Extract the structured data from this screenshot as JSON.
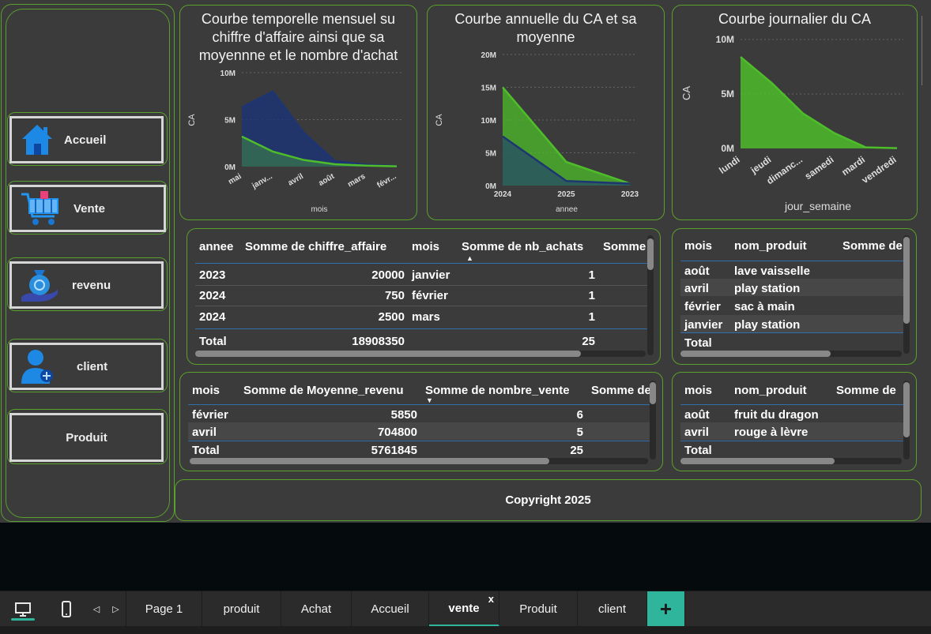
{
  "nav": {
    "accueil": "Accueil",
    "vente": "Vente",
    "revenu": "revenu",
    "client": "client",
    "produit": "Produit"
  },
  "charts": {
    "monthly": {
      "title_l1": "Courbe temporelle mensuel su",
      "title_l2": "chiffre d'affaire ainsi que sa",
      "title_l3": "moyennne et le nombre d'achat",
      "ylabel": "CA",
      "xlabel": "mois",
      "yticks": [
        "10M",
        "5M",
        "0M"
      ],
      "xticks": [
        "mai",
        "janv...",
        "avril",
        "août",
        "mars",
        "févr..."
      ]
    },
    "annual": {
      "title_l1": "Courbe annuelle du CA et sa",
      "title_l2": "moyenne",
      "ylabel": "CA",
      "xlabel": "annee",
      "yticks": [
        "20M",
        "15M",
        "10M",
        "5M",
        "0M"
      ],
      "xticks": [
        "2024",
        "2025",
        "2023"
      ]
    },
    "daily": {
      "title": "Courbe journalier du CA",
      "ylabel": "CA",
      "xlabel": "jour_semaine",
      "yticks": [
        "10M",
        "5M",
        "0M"
      ],
      "xticks": [
        "lundi",
        "jeudi",
        "dimanc...",
        "samedi",
        "mardi",
        "vendredi"
      ]
    }
  },
  "chart_data": [
    {
      "type": "area",
      "title": "Courbe temporelle mensuel su chiffre d'affaire ainsi que sa moyennne et le nombre d'achat",
      "xlabel": "mois",
      "ylabel": "CA",
      "categories": [
        "mai",
        "janv...",
        "avril",
        "août",
        "mars",
        "févr..."
      ],
      "ylim": [
        0,
        10000000
      ],
      "series": [
        {
          "values": [
            6300000,
            8000000,
            3600000,
            600000,
            200000,
            50000
          ]
        },
        {
          "values": [
            3200000,
            1600000,
            700000,
            250000,
            100000,
            30000
          ]
        }
      ]
    },
    {
      "type": "area",
      "title": "Courbe annuelle du CA et sa moyenne",
      "xlabel": "annee",
      "ylabel": "CA",
      "categories": [
        "2024",
        "2025",
        "2023"
      ],
      "ylim": [
        0,
        20000000
      ],
      "series": [
        {
          "values": [
            15000000,
            3600000,
            300000
          ]
        },
        {
          "values": [
            7500000,
            700000,
            300000
          ]
        }
      ]
    },
    {
      "type": "area",
      "title": "Courbe journalier du CA",
      "xlabel": "jour_semaine",
      "ylabel": "CA",
      "categories": [
        "lundi",
        "jeudi",
        "dimanc...",
        "samedi",
        "mardi",
        "vendredi"
      ],
      "ylim": [
        0,
        10000000
      ],
      "series": [
        {
          "values": [
            8400000,
            6000000,
            3200000,
            1400000,
            100000,
            30000
          ]
        }
      ]
    }
  ],
  "colors": {
    "accent_green": "#5aa02c",
    "area_green": "#4ebd2a",
    "area_navy": "#1e3574",
    "tab_active": "#2fb59c"
  },
  "table1": {
    "headers": [
      "annee",
      "Somme de chiffre_affaire",
      "mois",
      "Somme de nb_achats",
      "Somme"
    ],
    "rows": [
      [
        "2023",
        "20000",
        "janvier",
        "1"
      ],
      [
        "2024",
        "750",
        "février",
        "1"
      ],
      [
        "2024",
        "2500",
        "mars",
        "1"
      ]
    ],
    "total": [
      "Total",
      "18908350",
      "",
      "25"
    ]
  },
  "table2": {
    "headers": [
      "mois",
      "nom_produit",
      "Somme de"
    ],
    "rows": [
      [
        "août",
        "lave vaisselle"
      ],
      [
        "avril",
        "play station"
      ],
      [
        "février",
        "sac à main"
      ],
      [
        "janvier",
        "play station"
      ]
    ],
    "total": "Total"
  },
  "table3": {
    "headers": [
      "mois",
      "Somme de Moyenne_revenu",
      "Somme de nombre_vente",
      "Somme de"
    ],
    "rows": [
      [
        "février",
        "5850",
        "6"
      ],
      [
        "avril",
        "704800",
        "5"
      ]
    ],
    "total": [
      "Total",
      "5761845",
      "25"
    ]
  },
  "table4": {
    "headers": [
      "mois",
      "nom_produit",
      "Somme de"
    ],
    "rows": [
      [
        "août",
        "fruit du dragon"
      ],
      [
        "avril",
        "rouge à lèvre"
      ]
    ],
    "total": "Total"
  },
  "footer": "Copyright 2025",
  "tabs": [
    "Page 1",
    "produit",
    "Achat",
    "Accueil",
    "vente",
    "Produit",
    "client"
  ],
  "tab_active": "vente",
  "tab_close": "x",
  "add_tab": "+"
}
